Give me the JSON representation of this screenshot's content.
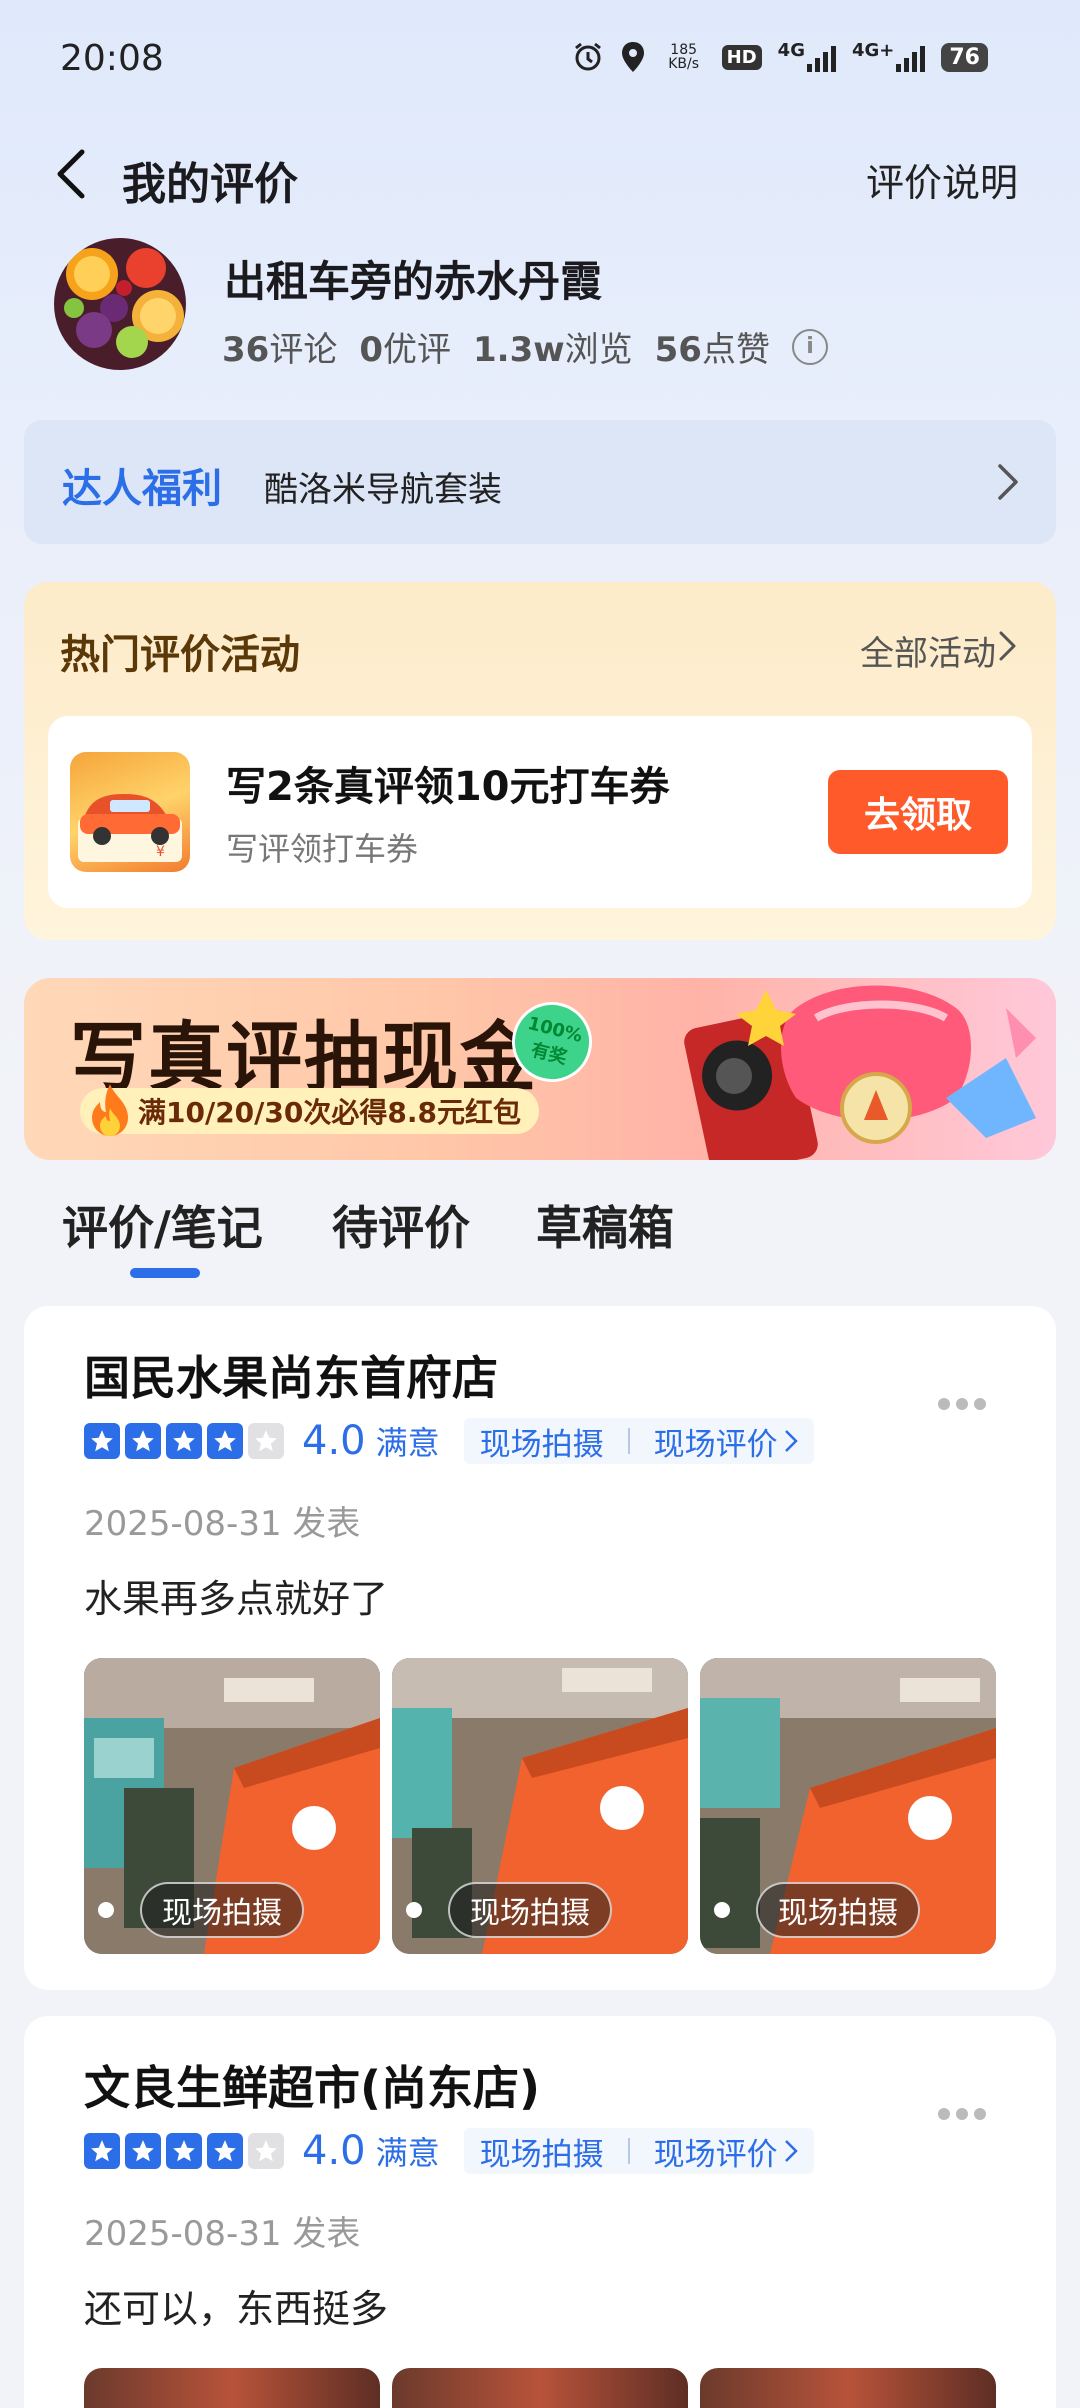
{
  "status_bar": {
    "time": "20:08",
    "net_speed_value": "185",
    "net_speed_unit": "KB/s",
    "hd_label": "HD",
    "sim1_label": "4G",
    "sim2_label": "4G+",
    "battery": "76",
    "icons": [
      "alarm-icon",
      "location-icon",
      "hd-icon",
      "signal-icon",
      "signal-icon",
      "battery-icon"
    ]
  },
  "header": {
    "title": "我的评价",
    "link": "评价说明"
  },
  "profile": {
    "username": "出租车旁的赤水丹霞",
    "stats": [
      {
        "value": "36",
        "label": "评论"
      },
      {
        "value": "0",
        "label": "优评"
      },
      {
        "value": "1.3w",
        "label": "浏览"
      },
      {
        "value": "56",
        "label": "点赞"
      }
    ]
  },
  "perks": {
    "title": "达人福利",
    "desc": "酷洛米导航套装"
  },
  "activity": {
    "title": "热门评价活动",
    "all_label": "全部活动",
    "item": {
      "name": "写2条真评领10元打车券",
      "sub": "写评领打车券",
      "button": "去领取"
    }
  },
  "promo": {
    "headline": "写真评抽现金",
    "badge_line1": "100%",
    "badge_line2": "有奖",
    "sub": "满10/20/30次必得8.8元红包"
  },
  "tabs": [
    {
      "label": "评价/笔记",
      "active": true
    },
    {
      "label": "待评价",
      "active": false
    },
    {
      "label": "草稿箱",
      "active": false
    }
  ],
  "reviews": [
    {
      "store": "国民水果尚东首府店",
      "rating": 4,
      "score": "4.0",
      "satisfaction": "满意",
      "tag1": "现场拍摄",
      "tag2": "现场评价",
      "date": "2025-08-31 发表",
      "content": "水果再多点就好了",
      "photos": [
        "现场拍摄",
        "现场拍摄",
        "现场拍摄"
      ]
    },
    {
      "store": "文良生鲜超市(尚东店)",
      "rating": 4,
      "score": "4.0",
      "satisfaction": "满意",
      "tag1": "现场拍摄",
      "tag2": "现场评价",
      "date": "2025-08-31 发表",
      "content": "还可以，东西挺多"
    }
  ],
  "colors": {
    "accent": "#2c6ee8",
    "cta": "#ff5a2a",
    "activity_title": "#5b3807"
  }
}
